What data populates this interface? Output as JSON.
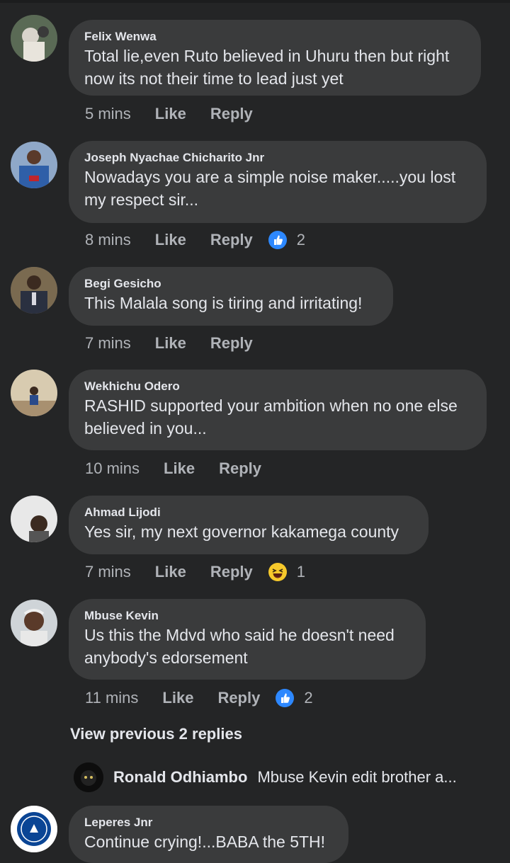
{
  "comments": [
    {
      "author": "Felix Wenwa",
      "text_line1": "Total lie,even Ruto believed in Uhuru then but right",
      "text_line2": "now its not their time to lead just yet",
      "time": "5 mins",
      "like": "Like",
      "reply": "Reply"
    },
    {
      "author": "Joseph Nyachae Chicharito Jnr",
      "text_line1": "Nowadays you are a simple noise maker.....you lost",
      "text_line2": "my respect sir...",
      "time": "8 mins",
      "like": "Like",
      "reply": "Reply",
      "reaction_icon": "like-reaction-icon",
      "reaction_count": "2"
    },
    {
      "author": "Begi Gesicho",
      "text_line1": "This Malala song is tiring and irritating!",
      "time": "7 mins",
      "like": "Like",
      "reply": "Reply"
    },
    {
      "author": "Wekhichu Odero",
      "text_line1": "RASHID supported your ambition when no one else",
      "text_line2": "believed in you...",
      "time": "10 mins",
      "like": "Like",
      "reply": "Reply"
    },
    {
      "author": "Ahmad Lijodi",
      "text_line1": "Yes sir, my next governor kakamega county",
      "time": "7 mins",
      "like": "Like",
      "reply": "Reply",
      "reaction_icon": "haha-reaction-icon",
      "reaction_count": "1"
    },
    {
      "author": "Mbuse Kevin",
      "text_line1": "Us this the Mdvd who said he doesn't need",
      "text_line2": "anybody's edorsement",
      "time": "11 mins",
      "like": "Like",
      "reply": "Reply",
      "reaction_icon": "like-reaction-icon",
      "reaction_count": "2"
    }
  ],
  "view_previous": "View previous 2 replies",
  "nested_reply": {
    "author": "Ronald Odhiambo",
    "snippet": "Mbuse Kevin edit brother a..."
  },
  "last_comment": {
    "author": "Leperes Jnr",
    "text_line1": "Continue crying!...BABA the 5TH!"
  },
  "colors": {
    "background": "#242526",
    "bubble": "#3a3b3c",
    "text": "#e4e6eb",
    "secondary": "#b0b3b8",
    "like_blue": "#2d88ff",
    "haha_yellow": "#f7c92b"
  }
}
